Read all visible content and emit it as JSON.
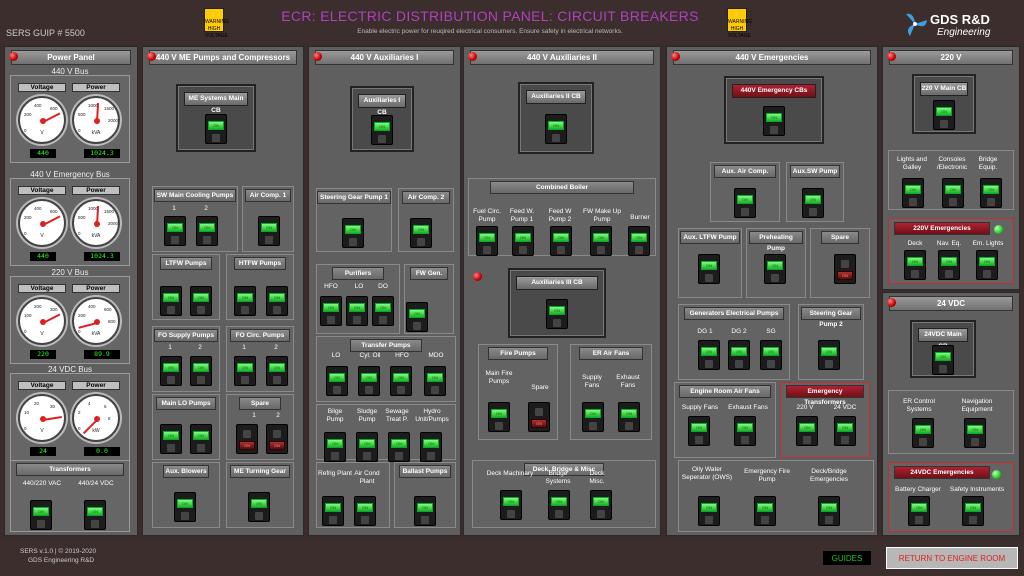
{
  "header": {
    "guip": "SERS GUIP # 5500",
    "title": "ECR: ELECTRIC DISTRIBUTION PANEL: CIRCUIT BREAKERS",
    "subtitle": "Enable electric power for reuqired electrical consumers. Ensure safety in electrical networks.",
    "warning_sign": "WARNING HIGH VOLTAGE",
    "logo_title": "GDS R&D",
    "logo_sub": "Engineering"
  },
  "power_panel": {
    "title": "Power Panel",
    "voltage_label": "Voltage",
    "power_label": "Power",
    "buses": [
      {
        "name": "440 V Bus",
        "voltage": "440",
        "power": "1024.3",
        "v_unit": "V",
        "p_unit": "kVA",
        "v_scale": [
          "0",
          "200",
          "400",
          "600"
        ],
        "p_scale": [
          "0",
          "500",
          "1000",
          "1500",
          "2000"
        ]
      },
      {
        "name": "440 V Emergency Bus",
        "voltage": "440",
        "power": "1024.3",
        "v_unit": "V",
        "p_unit": "kVA",
        "v_scale": [
          "0",
          "200",
          "400",
          "600"
        ],
        "p_scale": [
          "0",
          "500",
          "1000",
          "1500",
          "2000"
        ]
      },
      {
        "name": "220 V Bus",
        "voltage": "220",
        "power": "89.9",
        "v_unit": "V",
        "p_unit": "kVA",
        "v_scale": [
          "0",
          "100",
          "200",
          "300"
        ],
        "p_scale": [
          "0",
          "200",
          "400",
          "600",
          "800"
        ]
      },
      {
        "name": "24 VDC Bus",
        "voltage": "24",
        "power": "0.0",
        "v_unit": "V",
        "p_unit": "kW",
        "v_scale": [
          "0",
          "10",
          "20",
          "30"
        ],
        "p_scale": [
          "0",
          "2",
          "4",
          "6",
          "8"
        ]
      }
    ],
    "transformers": {
      "title": "Transformers",
      "t1": "440/220 VAC",
      "t2": "440/24 VDC"
    }
  },
  "me_pumps": {
    "title": "440 V ME Pumps and Compressors",
    "main_cb": "ME Systems Main CB",
    "sw_cool": "SW Main Cooling Pumps",
    "air_comp1": "Air Comp. 1",
    "ltfw": "LTFW Pumps",
    "htfw": "HTFW Pumps",
    "fo_supply": "FO Supply Pumps",
    "fo_circ": "FO Circ. Pumps",
    "main_lo": "Main LO Pumps",
    "spare": "Spare",
    "aux_blowers": "Aux. Blowers",
    "me_turning": "ME Turning Gear",
    "n1": "1",
    "n2": "2"
  },
  "aux1": {
    "title": "440 V Auxiliaries I",
    "main_cb": "Auxiliaries I CB",
    "steering": "Steering Gear Pump 1",
    "air_comp2": "Air Comp. 2",
    "purifiers": "Purifiers",
    "fw_gen": "FW Gen.",
    "hfo": "HFO",
    "lo": "LO",
    "do": "DO",
    "transfer": "Transfer Pumps",
    "t_lo": "LO",
    "t_cyl": "Cyl. Oil",
    "t_hfo": "HFO",
    "t_mdo": "MDO",
    "bilge": "Bilge Pump",
    "sludge": "Sludge Pump",
    "sewage": "Sewage Treat P.",
    "hydro": "Hydro Unit/Pumps",
    "refrig": "Refrig Plant",
    "aircond": "Air Cond Plant",
    "ballast": "Ballast Pumps"
  },
  "aux2": {
    "title": "440 V Auxiliaries II",
    "main_cb": "Auxiliaries II CB",
    "boiler": "Combined Boiler",
    "fuel_circ": "Fuel Circ. Pump",
    "feedw1": "Feed W. Pump 1",
    "feedw2": "Feed W Pump 2",
    "fw_makeup": "FW Make Up Pump",
    "burner": "Burner",
    "main_cb3": "Auxiliaries III CB",
    "fire": "Fire Pumps",
    "main_fire": "Main Fire Pumps",
    "spare": "Spare",
    "er_fans": "ER Air Fans",
    "supply": "Supply Fans",
    "exhaust": "Exhaust Fans",
    "deck": "Deck, Bridge & Misc",
    "deck_mach": "Deck Machinary",
    "bridge": "Bridge Systems",
    "deck_misc": "Deck Misc."
  },
  "emerg": {
    "title": "440 V Emergencies",
    "main_cb": "440V Emergency CBs",
    "aux_air": "Aux. Air Comp.",
    "aux_sw": "Aux.SW Pump",
    "aux_ltfw": "Aux. LTFW Pump",
    "preheat": "Preheating Pump",
    "spare": "Spare",
    "gen_pumps": "Generators Electrical Pumps",
    "dg1": "DG 1",
    "dg2": "DG 2",
    "sg": "SG",
    "steer2": "Steering Gear Pump 2",
    "er_fans": "Engine Room Air Fans",
    "supply": "Supply Fans",
    "exhaust": "Exhaust Fans",
    "em_trans": "Emergency Transformers",
    "v220": "220 V",
    "v24": "24 VDC",
    "ows": "Oily Water Seperator (OWS)",
    "em_fire": "Emergency Fire Pump",
    "deck_em": "Deck/Bridge Emergencies"
  },
  "v220": {
    "title": "220 V",
    "main_cb": "220 V Main CB",
    "lights": "Lights and Galley",
    "consoles": "Consoles /Electronic",
    "bridge": "Bridge Equip.",
    "em": "220V Emergencies",
    "deck": "Deck",
    "nav": "Nav. Eq.",
    "emlights": "Em. Lights"
  },
  "v24": {
    "title": "24 VDC",
    "main_cb": "24VDC Main CB",
    "er_ctrl": "ER Control Systems",
    "nav": "Navigation Equipment",
    "em": "24VDC Emergencies",
    "battery": "Battery Charger",
    "safety": "Safety Instruments"
  },
  "footer": {
    "version": "SERS v.1.0 | © 2019-2020",
    "company": "GDS Engineering R&D",
    "guides": "GUIDES",
    "return": "RETURN TO ENGINE ROOM"
  },
  "breaker_on_label": "ON"
}
